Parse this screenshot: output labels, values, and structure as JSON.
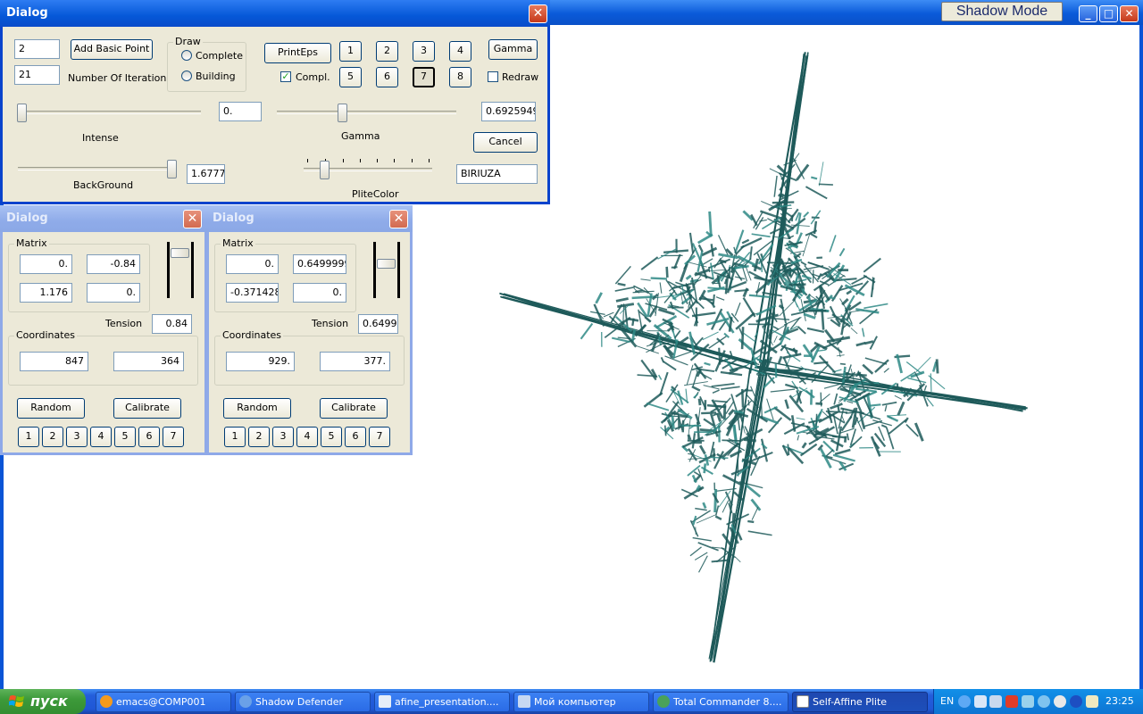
{
  "app": {
    "shadow_mode_label": "Shadow Mode",
    "minimize_glyph": "_",
    "maximize_glyph": "□",
    "close_glyph": "✕"
  },
  "main_dialog": {
    "title": "Dialog",
    "close_glyph": "✕",
    "basic_points_value": "2",
    "add_basic_point_label": "Add Basic Point",
    "iterations_value": "21",
    "iterations_label": "Number Of Iteration",
    "draw_group_title": "Draw",
    "draw_complete_label": "Complete",
    "draw_building_label": "Building",
    "print_eps_label": "PrintEps",
    "compl_label": "Compl.",
    "compl_checked": "✓",
    "number_buttons": [
      "1",
      "2",
      "3",
      "4",
      "5",
      "6",
      "7",
      "8"
    ],
    "selected_number": "7",
    "gamma_button_label": "Gamma",
    "redraw_label": "Redraw",
    "intense_value": "0.",
    "intense_label": "Intense",
    "gamma_value": "0.6925949",
    "gamma_label": "Gamma",
    "cancel_label": "Cancel",
    "background_value": "1.6777",
    "background_label": "BackGround",
    "plite_color_label": "PliteColor",
    "plite_color_value": "BIRIUZA"
  },
  "point_dialogs": [
    {
      "title": "Dialog",
      "close_glyph": "✕",
      "matrix_title": "Matrix",
      "matrix": [
        "0.",
        "-0.84",
        "1.176",
        "0."
      ],
      "tension_label": "Tension",
      "tension_value": "0.84",
      "coordinates_title": "Coordinates",
      "coord_x": "847",
      "coord_y": "364",
      "random_label": "Random",
      "calibrate_label": "Calibrate",
      "number_buttons": [
        "1",
        "2",
        "3",
        "4",
        "5",
        "6",
        "7"
      ]
    },
    {
      "title": "Dialog",
      "close_glyph": "✕",
      "matrix_title": "Matrix",
      "matrix": [
        "0.",
        "0.6499999",
        "-0.371428",
        "0."
      ],
      "tension_label": "Tension",
      "tension_value": "0.6499",
      "coordinates_title": "Coordinates",
      "coord_x": "929.",
      "coord_y": "377.",
      "random_label": "Random",
      "calibrate_label": "Calibrate",
      "number_buttons": [
        "1",
        "2",
        "3",
        "4",
        "5",
        "6",
        "7"
      ]
    }
  ],
  "fractal": {
    "color": "#1e5a5a",
    "highlight": "#2f8a86"
  },
  "taskbar": {
    "start_label": "пуск",
    "tasks": [
      {
        "label": "emacs@COMP001",
        "icon": "emacs-icon",
        "color": "#f39a1e"
      },
      {
        "label": "Shadow Defender",
        "icon": "shadow-defender-icon",
        "color": "#6aa1e8"
      },
      {
        "label": "afine_presentation....",
        "icon": "document-icon",
        "color": "#e6eef8"
      },
      {
        "label": "Мой компьютер",
        "icon": "my-computer-icon",
        "color": "#c7d8f2"
      },
      {
        "label": "Total Commander 8....",
        "icon": "total-commander-icon",
        "color": "#4aa25a"
      },
      {
        "label": "Self-Affine Plite",
        "icon": "app-window-icon",
        "color": "#ffffff"
      }
    ],
    "language": "EN",
    "clock": "23:25"
  }
}
